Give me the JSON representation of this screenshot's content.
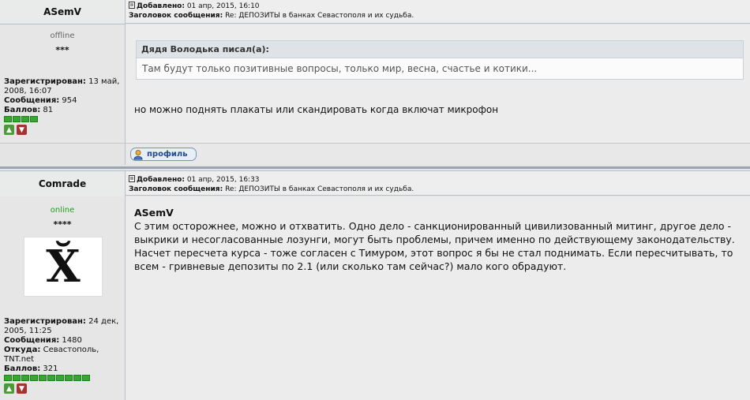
{
  "posts": [
    {
      "author": "ASemV",
      "status": "offline",
      "stars": "***",
      "added_label": "Добавлено:",
      "added_value": "01 апр, 2015, 16:10",
      "subject_label": "Заголовок сообщения:",
      "subject_value": "Re: ДЕПОЗИТЫ в банках Севастополя и их судьба.",
      "registered_label": "Зарегистрирован:",
      "registered_value": "13 май, 2008, 16:07",
      "messages_label": "Сообщения:",
      "messages_value": "954",
      "points_label": "Баллов:",
      "points_value": "81",
      "rating_blocks": 4,
      "quote_author": "Дядя Володька писал(а):",
      "quote_text": "Там будут только позитивные вопросы, только мир, весна, счастье и котики...",
      "text": "но можно поднять плакаты или скандировать когда включат микрофон",
      "profile_label": "профиль"
    },
    {
      "author": "Comrade",
      "status": "online",
      "stars": "****",
      "avatar_glyph": "X̆",
      "added_label": "Добавлено:",
      "added_value": "01 апр, 2015, 16:33",
      "subject_label": "Заголовок сообщения:",
      "subject_value": "Re: ДЕПОЗИТЫ в банках Севастополя и их судьба.",
      "registered_label": "Зарегистрирован:",
      "registered_value": "24 дек, 2005, 11:25",
      "messages_label": "Сообщения:",
      "messages_value": "1480",
      "location_label": "Откуда:",
      "location_value": "Севастополь, TNT.net",
      "points_label": "Баллов:",
      "points_value": "321",
      "rating_blocks": 10,
      "addressee": "ASemV",
      "text_lines": [
        "С этим осторожнее, можно и отхватить. Одно дело - санкционированный цивилизованный митинг, другое дело - выкрики и несогласованные лозунги, могут быть проблемы, причем именно по действующему законодательству.",
        "Насчет пересчета курса - тоже согласен с Тимуром, этот вопрос я бы не стал поднимать. Если пересчитывать, то всем - гривневые депозиты по 2.1 (или сколько там сейчас?) мало кого обрадуют."
      ]
    }
  ],
  "colors": {
    "online": "#1f9c1f",
    "offline": "#666666",
    "rating_green": "#35a82f"
  }
}
